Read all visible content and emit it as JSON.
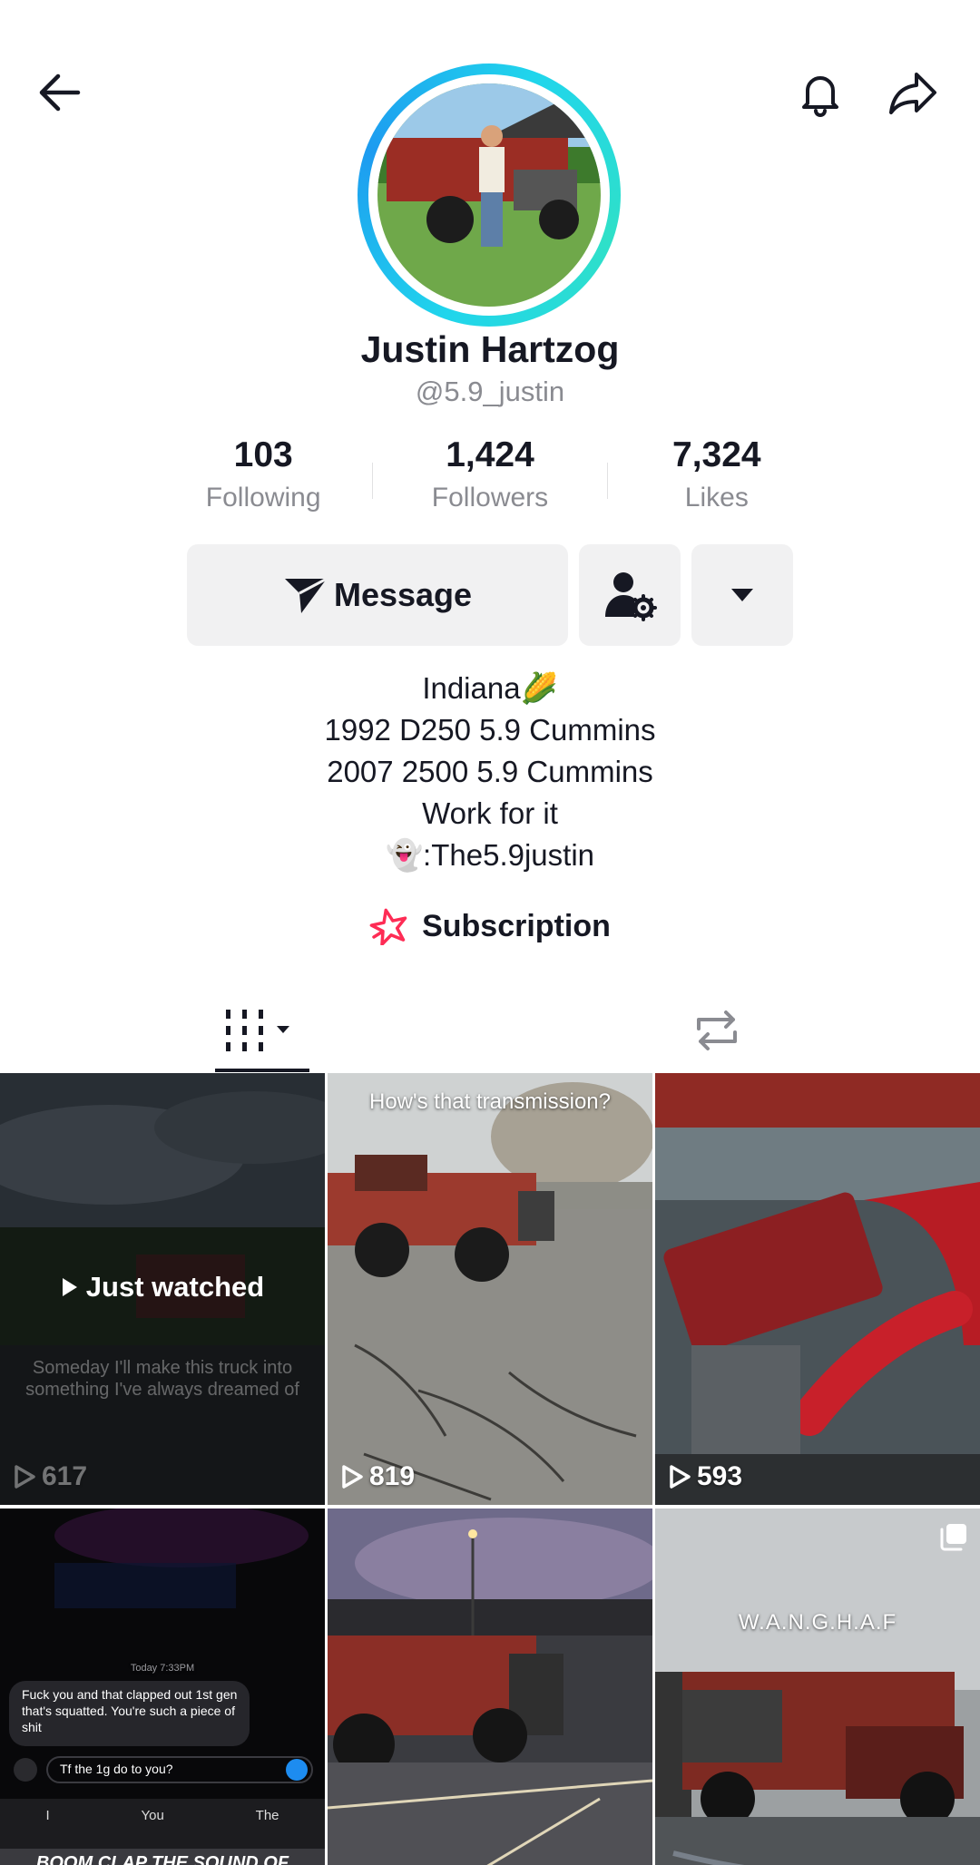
{
  "header": {
    "back_icon": "arrow-left-icon",
    "bell_icon": "bell-icon",
    "share_icon": "share-arrow-icon"
  },
  "profile": {
    "name": "Justin Hartzog",
    "handle": "@5.9_justin",
    "avatar_ring_color": "#20d5ec"
  },
  "stats": [
    {
      "value": "103",
      "label": "Following"
    },
    {
      "value": "1,424",
      "label": "Followers"
    },
    {
      "value": "7,324",
      "label": "Likes"
    }
  ],
  "actions": {
    "message_label": "Message",
    "message_icon": "paper-plane-icon",
    "friend_icon": "person-settings-icon",
    "more_icon": "caret-down-icon"
  },
  "bio": {
    "lines": [
      "Indiana🌽",
      "1992 D250 5.9 Cummins",
      "2007 2500 5.9 Cummins",
      "Work for it",
      "👻:The5.9justin"
    ]
  },
  "subscription": {
    "label": "Subscription",
    "icon": "star-icon",
    "color": "#fe2c55"
  },
  "tabs": {
    "videos_icon": "grid-icon",
    "reposts_icon": "repost-icon"
  },
  "videos": [
    {
      "views": "617",
      "just_watched": "Just watched",
      "caption": "Someday I'll make this truck into something I've always dreamed of"
    },
    {
      "views": "819",
      "caption": "How's that transmission?"
    },
    {
      "views": "593"
    },
    {
      "chat_time": "Today 7:33PM",
      "chat_msg": "Fuck you and that clapped out 1st gen that's squatted. You're such a piece of shit",
      "chat_reply": "Tf the 1g do to you?",
      "keys": [
        "I",
        "You",
        "The"
      ],
      "caption": "BOOM CLAP THE SOUND OF"
    },
    {},
    {
      "caption": "W.A.N.G.H.A.F"
    }
  ]
}
